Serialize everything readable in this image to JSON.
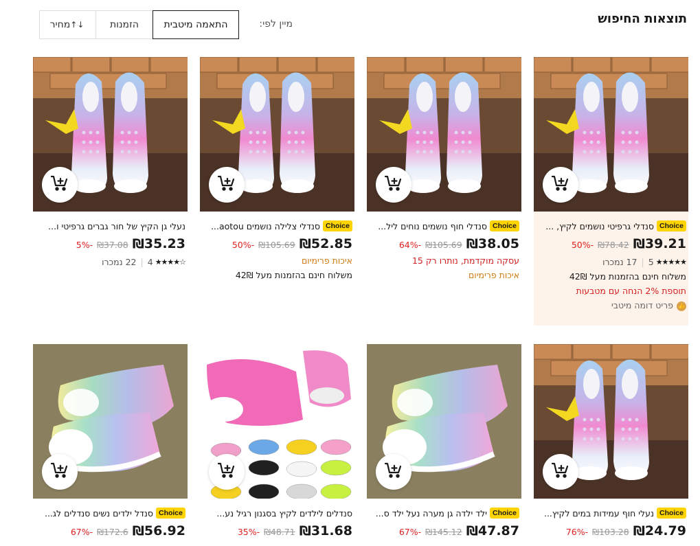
{
  "header": {
    "title": "תוצאות החיפוש",
    "sort_label": "מיין לפי:",
    "sort_options": [
      "התאמה מיטבית",
      "הזמנות",
      "מחיר"
    ],
    "sort_arrows": "↑↓"
  },
  "choice_label": "Choice",
  "products": [
    {
      "name": "סנדלי גרפיטי נושמים לקיץ, ...",
      "choice": true,
      "price": "₪39.21",
      "old_price": "₪78.42",
      "discount": "-50%",
      "rating": "5",
      "sold": "17 נמכרו",
      "lines": [
        {
          "text": "משלוח חינם בהזמנות מעל 42₪",
          "style": "dark"
        },
        {
          "text": "תוספת 2% הנחה עם מטבעות",
          "style": "red"
        },
        {
          "text": "פריט דומה מיטבי",
          "style": "gray",
          "icon": true
        }
      ],
      "image": "sneaker-top",
      "highlight": true
    },
    {
      "name": "סנדלי חוף נושמים נוחים ליל...",
      "choice": true,
      "price": "₪38.05",
      "old_price": "₪105.69",
      "discount": "-64%",
      "lines": [
        {
          "text": "עסקה מוקדמת, נותרו רק 15",
          "style": "red"
        },
        {
          "text": "איכות פרימיום",
          "style": "orange"
        }
      ],
      "image": "sneaker-top"
    },
    {
      "name": "סנדלי צלילה נושמים aotou...",
      "choice": true,
      "price": "₪52.85",
      "old_price": "₪105.69",
      "discount": "-50%",
      "lines": [
        {
          "text": "איכות פרימיום",
          "style": "orange"
        },
        {
          "text": "משלוח חינם בהזמנות מעל 42₪",
          "style": "dark"
        }
      ],
      "image": "sneaker-top"
    },
    {
      "name": "נעלי גן הקיץ של חור גברים גרפיטי ו...",
      "choice": false,
      "price": "₪35.23",
      "old_price": "₪37.08",
      "discount": "-5%",
      "rating": "4",
      "sold": "22 נמכרו",
      "lines": [],
      "image": "sneaker-top"
    },
    {
      "name": "נעלי חוף עמידות במים לקיץ...",
      "choice": true,
      "price": "₪24.79",
      "old_price": "₪103.28",
      "discount": "-76%",
      "lines": [],
      "image": "sneaker-side-dark"
    },
    {
      "name": "ילד ילדה גן מערה נעל ילד ס...",
      "choice": true,
      "price": "₪47.87",
      "old_price": "₪145.12",
      "discount": "-67%",
      "lines": [],
      "image": "sneaker-side-grey"
    },
    {
      "name": "סנדלים לילדים לקיץ בסגנון רגיל נע...",
      "choice": false,
      "price": "₪31.68",
      "old_price": "₪48.71",
      "discount": "-35%",
      "lines": [],
      "image": "pink-collection"
    },
    {
      "name": "סנדל ילדים נשים סנדלים לג...",
      "choice": true,
      "price": "₪56.92",
      "old_price": "₪172.6",
      "discount": "-67%",
      "lines": [],
      "image": "sneaker-side-grey"
    }
  ]
}
